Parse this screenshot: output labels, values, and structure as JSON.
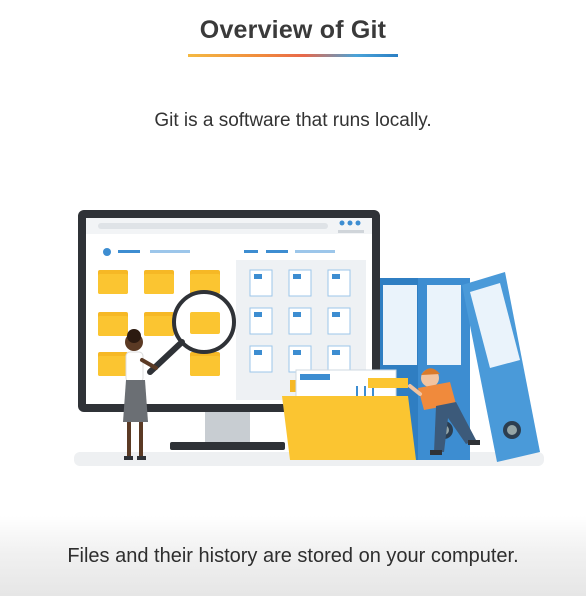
{
  "slide": {
    "title": "Overview of Git",
    "subtitle": "Git is a software that runs locally.",
    "caption": "Files and their history are stored on your computer."
  },
  "colors": {
    "folder_yellow": "#fbc531",
    "binder_blue": "#3d8dd1",
    "monitor_dark": "#2f3237",
    "accent_orange": "#f08a3c"
  },
  "icons": [
    "monitor-icon",
    "folder-icon",
    "document-icon",
    "magnifier-icon",
    "binder-icon",
    "person-icon"
  ]
}
